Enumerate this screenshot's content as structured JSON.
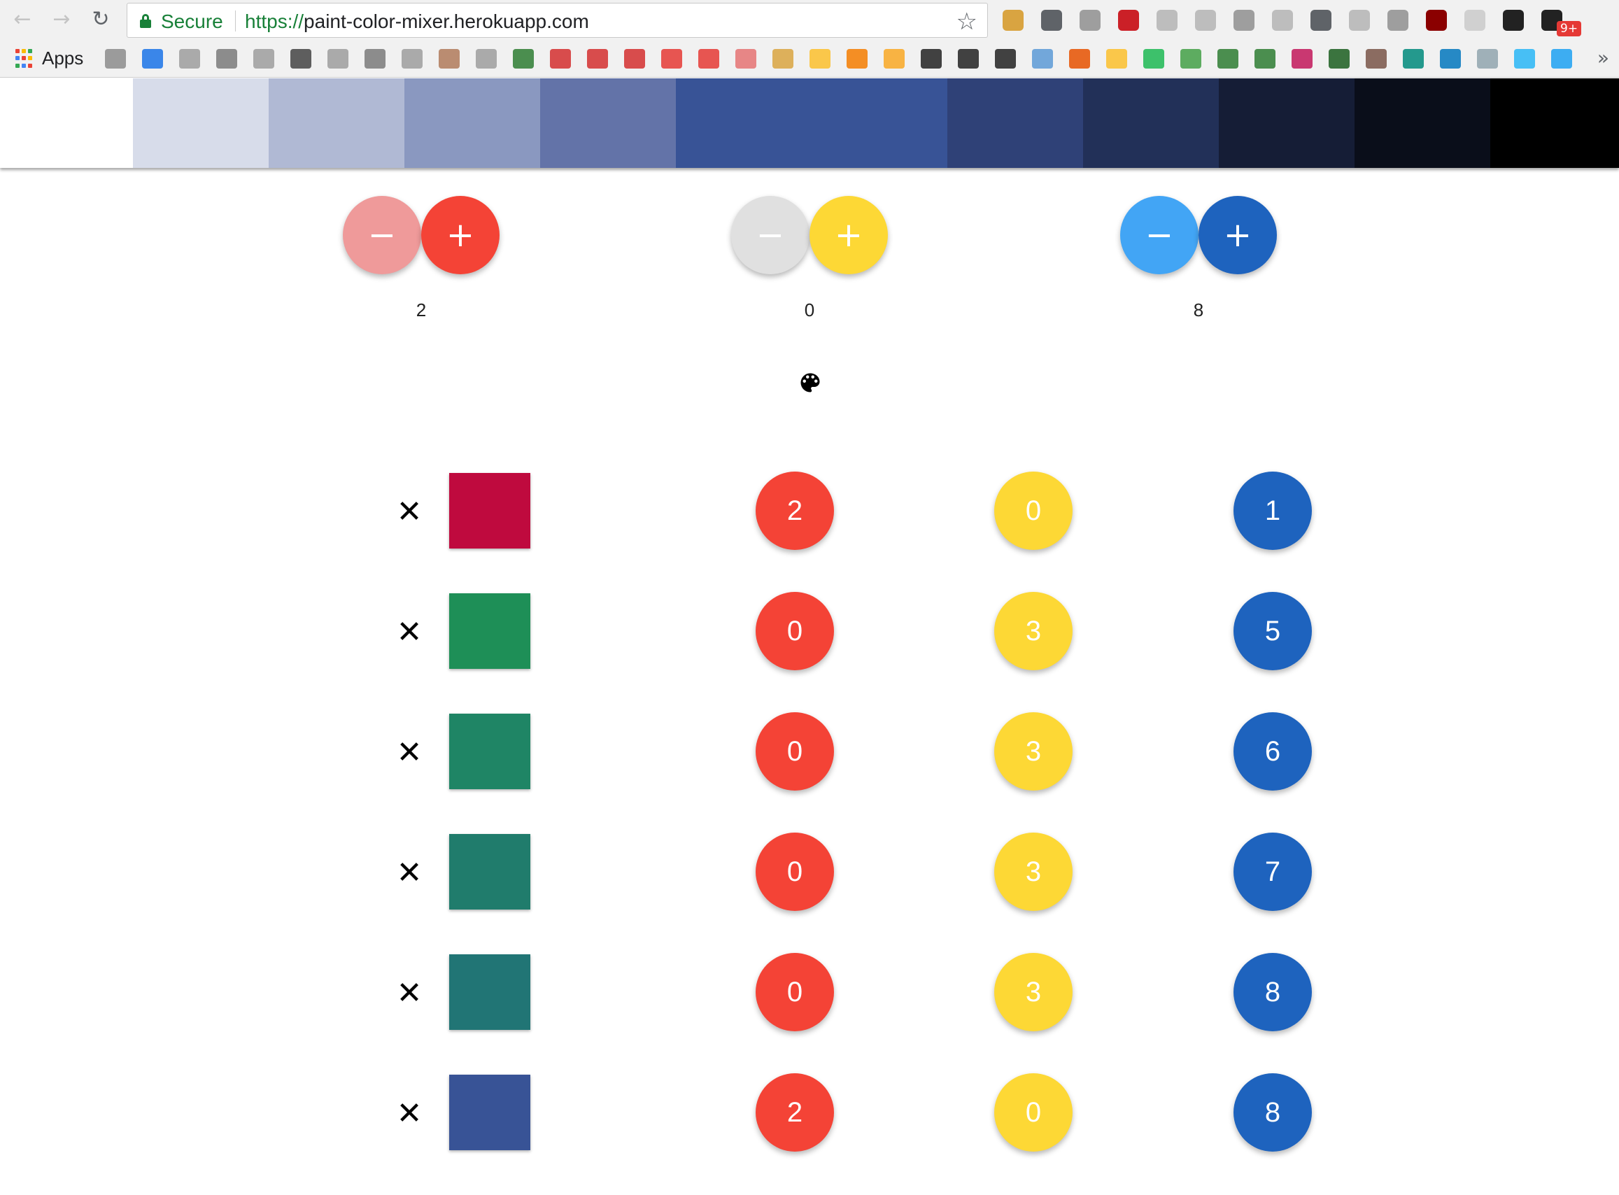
{
  "browser": {
    "secure_label": "Secure",
    "url_scheme": "https://",
    "url_host": "paint-color-mixer.herokuapp.com",
    "bookmarks_apps_label": "Apps",
    "extension_badge": "9+"
  },
  "palette_strip": {
    "colors": [
      "#ffffff",
      "#d7dcea",
      "#b0b9d4",
      "#8a98c0",
      "#6373a8",
      "#385396",
      "#2f4177",
      "#223058",
      "#151d36",
      "#0a0e1a",
      "#000000"
    ]
  },
  "controls": {
    "red": {
      "minus_label": "−",
      "plus_label": "+",
      "count": "2",
      "minus_color": "#ef9a9a",
      "plus_color": "#f44336"
    },
    "yellow": {
      "minus_label": "−",
      "plus_label": "+",
      "count": "0",
      "minus_color": "#e0e0e0",
      "plus_color": "#fdd835"
    },
    "blue": {
      "minus_label": "−",
      "plus_label": "+",
      "count": "8",
      "minus_color": "#42a5f5",
      "plus_color": "#1e63be"
    }
  },
  "mix_icon": "palette-icon",
  "mixes": [
    {
      "remove_label": "✕",
      "swatch_color": "#bf0a3e",
      "red": "2",
      "yellow": "0",
      "blue": "1"
    },
    {
      "remove_label": "✕",
      "swatch_color": "#1e8f57",
      "red": "0",
      "yellow": "3",
      "blue": "5"
    },
    {
      "remove_label": "✕",
      "swatch_color": "#1f8565",
      "red": "0",
      "yellow": "3",
      "blue": "6"
    },
    {
      "remove_label": "✕",
      "swatch_color": "#207c6c",
      "red": "0",
      "yellow": "3",
      "blue": "7"
    },
    {
      "remove_label": "✕",
      "swatch_color": "#217575",
      "red": "0",
      "yellow": "3",
      "blue": "8"
    },
    {
      "remove_label": "✕",
      "swatch_color": "#385396",
      "red": "2",
      "yellow": "0",
      "blue": "8"
    }
  ]
}
